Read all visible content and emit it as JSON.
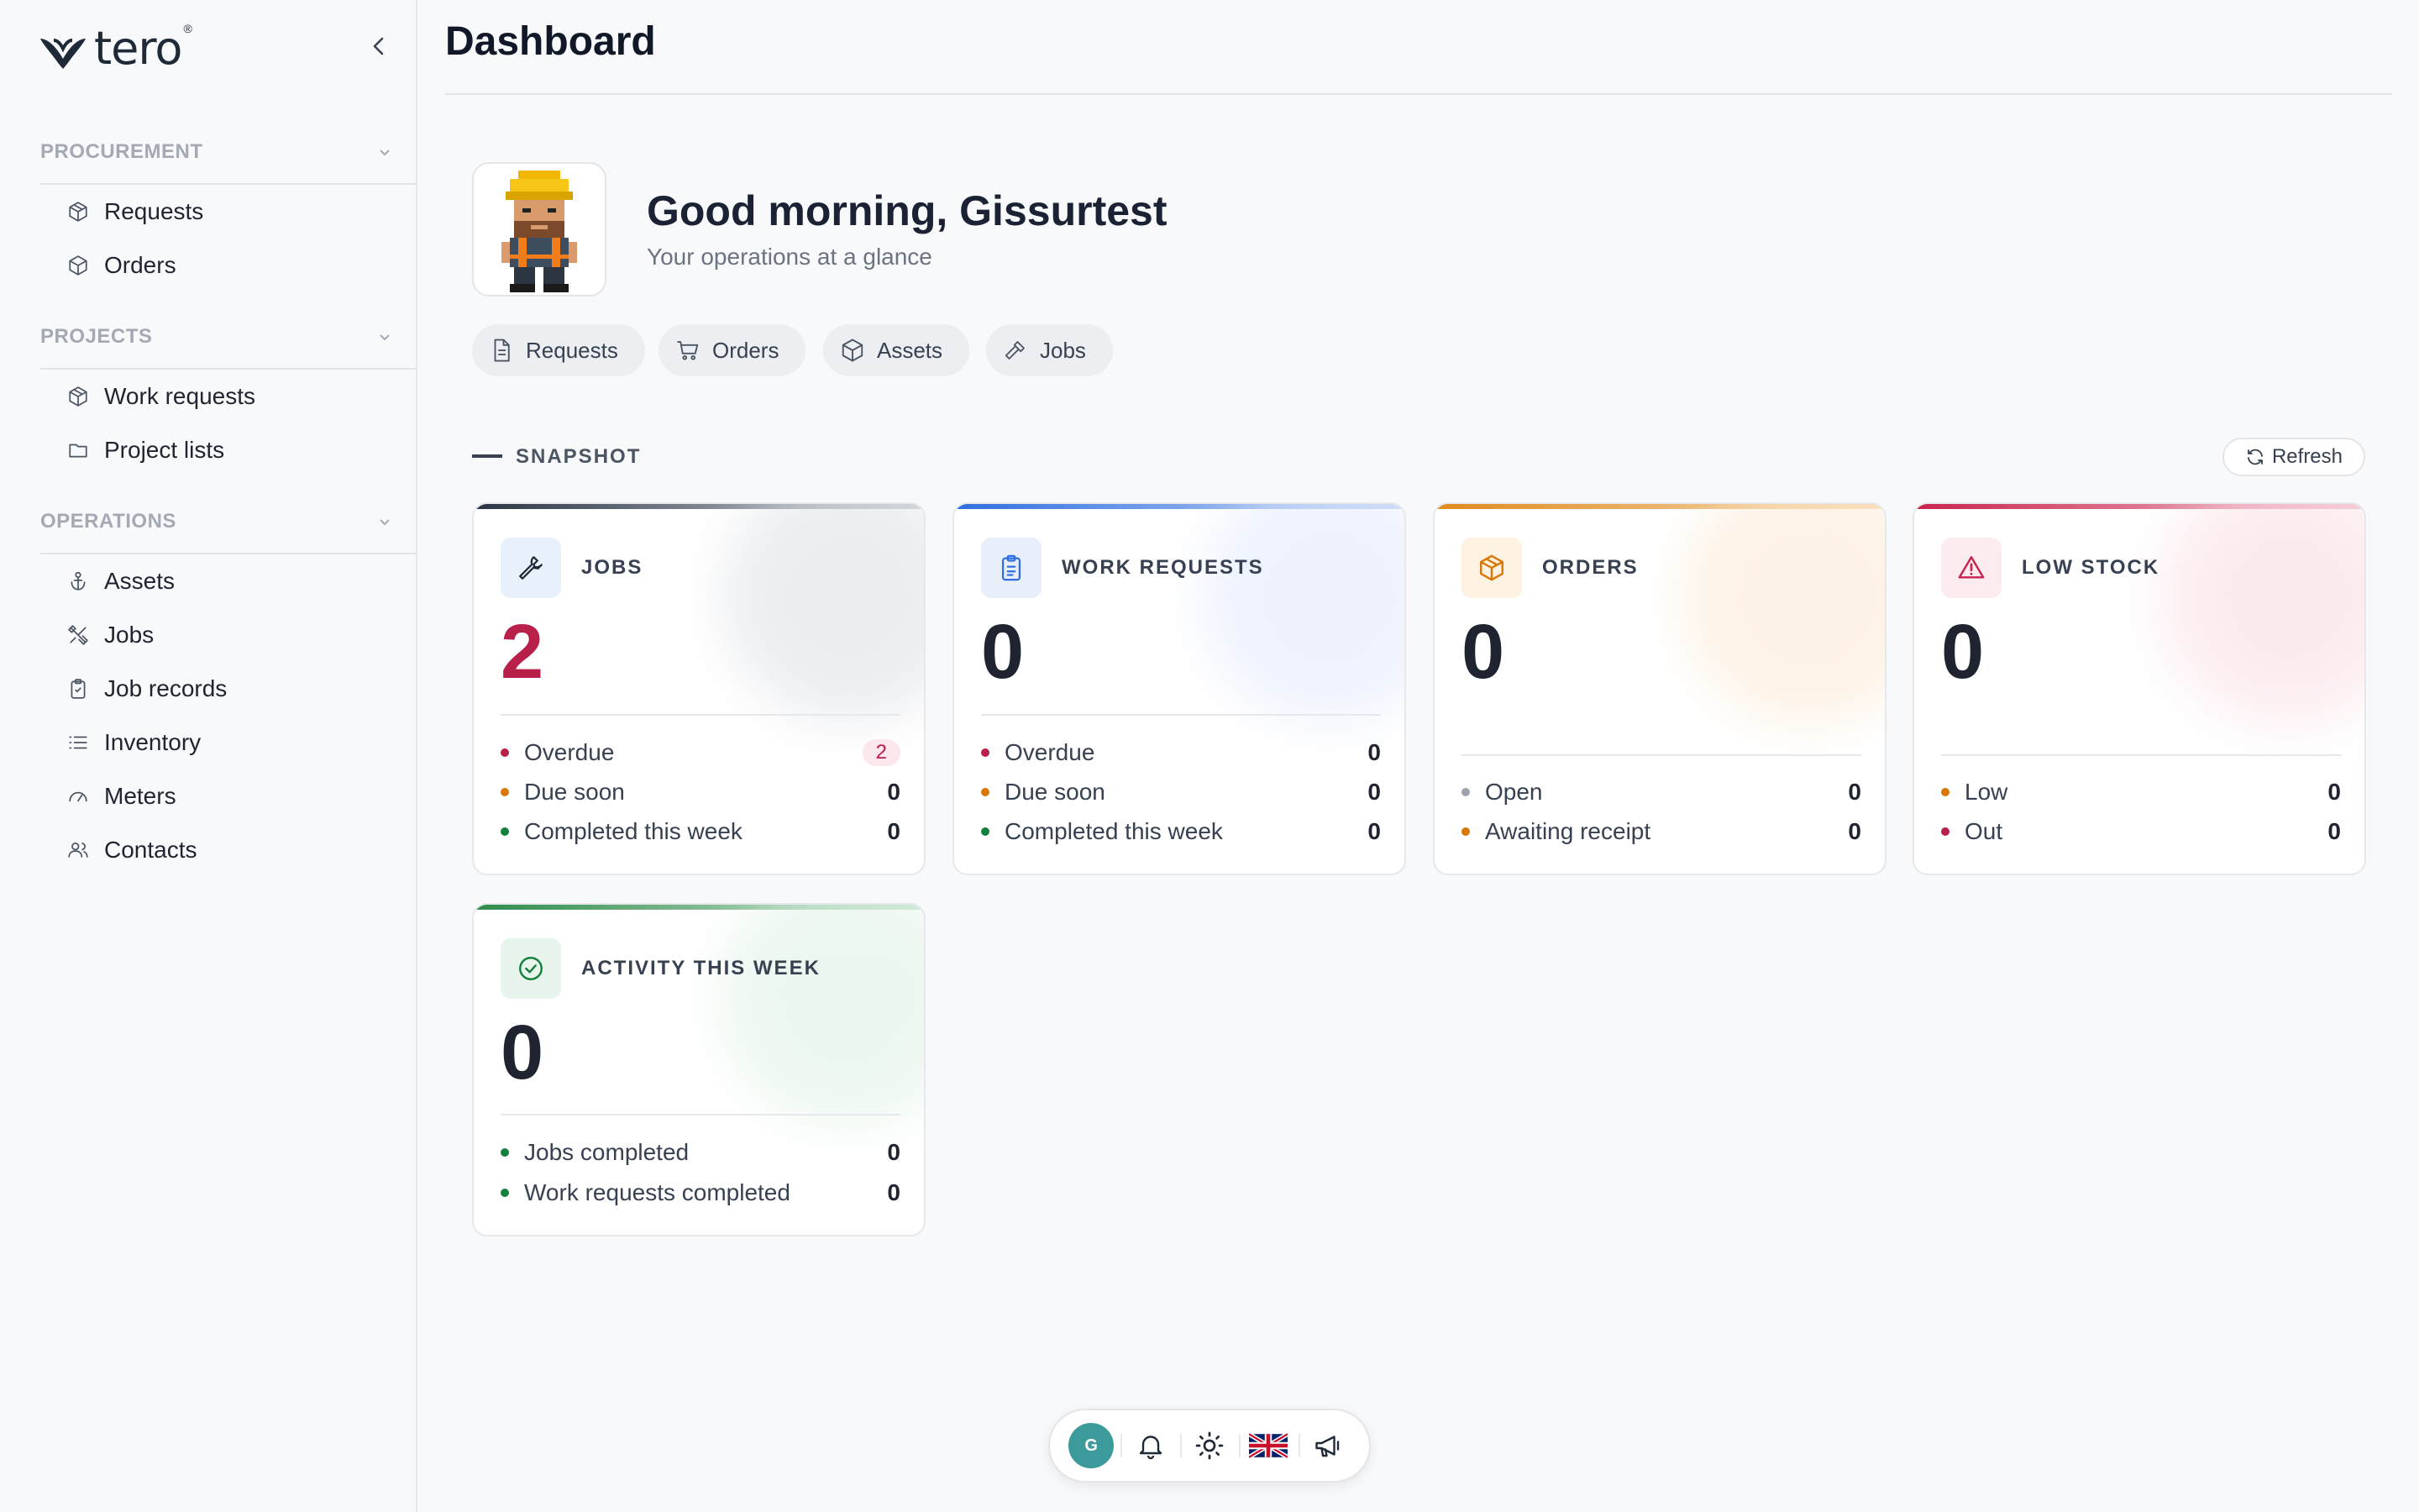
{
  "app": {
    "logo_text": "tero",
    "logo_mark": "®"
  },
  "sidebar": {
    "sections": [
      {
        "title": "PROCUREMENT",
        "items": [
          {
            "label": "Requests",
            "icon": "package-icon"
          },
          {
            "label": "Orders",
            "icon": "box-icon"
          }
        ]
      },
      {
        "title": "PROJECTS",
        "items": [
          {
            "label": "Work requests",
            "icon": "package-icon"
          },
          {
            "label": "Project lists",
            "icon": "folder-icon"
          }
        ]
      },
      {
        "title": "OPERATIONS",
        "items": [
          {
            "label": "Assets",
            "icon": "anchor-icon"
          },
          {
            "label": "Jobs",
            "icon": "tools-icon"
          },
          {
            "label": "Job records",
            "icon": "clipboard-check-icon"
          },
          {
            "label": "Inventory",
            "icon": "list-icon"
          },
          {
            "label": "Meters",
            "icon": "gauge-icon"
          },
          {
            "label": "Contacts",
            "icon": "users-icon"
          }
        ]
      }
    ]
  },
  "header": {
    "title": "Dashboard"
  },
  "welcome": {
    "greeting": "Good morning, Gissurtest",
    "subtitle": "Your operations at a glance"
  },
  "quick_links": [
    {
      "label": "Requests",
      "icon": "file-icon"
    },
    {
      "label": "Orders",
      "icon": "cart-icon"
    },
    {
      "label": "Assets",
      "icon": "box-icon"
    },
    {
      "label": "Jobs",
      "icon": "hammer-icon"
    }
  ],
  "snapshot": {
    "label": "SNAPSHOT",
    "refresh_label": "Refresh",
    "cards": [
      {
        "title": "JOBS",
        "value": "2",
        "accent": "#b8204a",
        "icon": "wrench-icon",
        "rows": [
          {
            "label": "Overdue",
            "value": "2",
            "dot": "#b8204a",
            "badge": true
          },
          {
            "label": "Due soon",
            "value": "0",
            "dot": "#d97706"
          },
          {
            "label": "Completed this week",
            "value": "0",
            "dot": "#15803d"
          }
        ]
      },
      {
        "title": "WORK REQUESTS",
        "value": "0",
        "accent": "#2f6fe0",
        "icon": "clipboard-list-icon",
        "rows": [
          {
            "label": "Overdue",
            "value": "0",
            "dot": "#b8204a"
          },
          {
            "label": "Due soon",
            "value": "0",
            "dot": "#d97706"
          },
          {
            "label": "Completed this week",
            "value": "0",
            "dot": "#15803d"
          }
        ]
      },
      {
        "title": "ORDERS",
        "value": "0",
        "accent": "#e08a1e",
        "icon": "package-icon",
        "rows": [
          {
            "label": "Open",
            "value": "0",
            "dot": "#9ca3af"
          },
          {
            "label": "Awaiting receipt",
            "value": "0",
            "dot": "#d97706"
          }
        ]
      },
      {
        "title": "LOW STOCK",
        "value": "0",
        "accent": "#c8234e",
        "icon": "alert-triangle-icon",
        "rows": [
          {
            "label": "Low",
            "value": "0",
            "dot": "#d97706"
          },
          {
            "label": "Out",
            "value": "0",
            "dot": "#b8204a"
          }
        ]
      },
      {
        "title": "ACTIVITY THIS WEEK",
        "value": "0",
        "accent": "#2e8b4a",
        "icon": "check-circle-icon",
        "rows": [
          {
            "label": "Jobs completed",
            "value": "0",
            "dot": "#15803d"
          },
          {
            "label": "Work requests completed",
            "value": "0",
            "dot": "#15803d"
          }
        ]
      }
    ]
  },
  "toolbar": {
    "avatar_initial": "G",
    "items": [
      "bell-icon",
      "sun-icon",
      "uk-flag-icon",
      "megaphone-icon"
    ]
  }
}
